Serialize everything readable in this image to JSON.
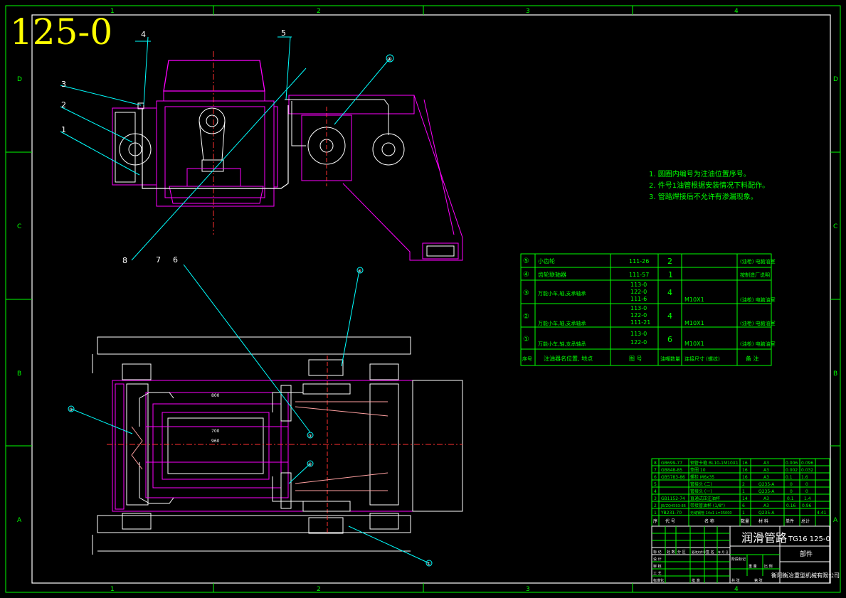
{
  "drawing": {
    "big_title": "125-0",
    "col_markers": [
      "1",
      "2",
      "3",
      "4"
    ],
    "row_markers": [
      "D",
      "C",
      "B",
      "A"
    ],
    "balloons_top": [
      "4",
      "5",
      "3",
      "2",
      "1",
      "8",
      "7",
      "6"
    ],
    "circle_refs": [
      "④",
      "⑤",
      "④",
      "③",
      "②",
      "①"
    ],
    "dims": [
      "800",
      "700",
      "960"
    ],
    "notes": [
      "1. 圆圈内编号为注油位置序号。",
      "2. 件号1油管根据安装情况下料配作。",
      "3. 管路焊接后不允许有渗漏现象。"
    ]
  },
  "parts_table": {
    "rows": [
      {
        "no": "⑤",
        "name": "小齿轮",
        "drawing": [
          "111-26"
        ],
        "qty": "2",
        "size": "",
        "note": "(油枪) 电脑油室"
      },
      {
        "no": "④",
        "name": "齿轮联轴器",
        "drawing": [
          "111-57"
        ],
        "qty": "1",
        "size": "",
        "note": "按制造厂说明"
      },
      {
        "no": "③",
        "name": "万能小车,轴,支承轴承",
        "drawing": [
          "113-0",
          "122-0",
          "111-6"
        ],
        "qty": "4",
        "size": "M10X1",
        "note": "(油枪) 电脑油室"
      },
      {
        "no": "②",
        "name": "万能小车,轴,支承轴承",
        "drawing": [
          "113-0",
          "122-0",
          "111-21"
        ],
        "qty": "4",
        "size": "M10X1",
        "note": "(油枪) 电脑油室"
      },
      {
        "no": "①",
        "name": "万能小车,轴,支承轴承",
        "drawing": [
          "113-0",
          "122-0"
        ],
        "qty": "6",
        "size": "M10X1",
        "note": "(油枪) 电脑油室"
      }
    ],
    "header": [
      "序号",
      "注油器名位置, 地点",
      "图 号",
      "油嘴数量",
      "连接尺寸 (螺纹)",
      "备 注"
    ]
  },
  "bom": {
    "rows": [
      {
        "idx": "8",
        "code": "GB699-77",
        "name": "钢管卡箍 BL10-1M10X1",
        "qty": "16",
        "mat": "A3",
        "w1": "0.006",
        "w2": "0.096"
      },
      {
        "idx": "7",
        "code": "GB848-85",
        "name": "垫圈 10",
        "qty": "16",
        "mat": "A3",
        "w1": "0.002",
        "w2": "0.032"
      },
      {
        "idx": "6",
        "code": "GB5783-86",
        "name": "螺栓 M6x35",
        "qty": "16",
        "mat": "A3",
        "w1": "0.1",
        "w2": "1.6"
      },
      {
        "idx": "5",
        "code": "",
        "name": "管接头 (二)",
        "qty": "2",
        "mat": "Q235-A",
        "w1": "0",
        "w2": "0"
      },
      {
        "idx": "4",
        "code": "",
        "name": "管接头 (一)",
        "qty": "1",
        "mat": "Q235-A",
        "w1": "0",
        "w2": "0"
      },
      {
        "idx": "3",
        "code": "GB1152-74",
        "name": "直通式压注油杯",
        "qty": "14",
        "mat": "A3",
        "w1": "0.1",
        "w2": "1.4"
      },
      {
        "idx": "2",
        "code": "JB/ZQ4593-86",
        "name": "带接管油杯 (1/8\")",
        "qty": "6",
        "mat": "A3",
        "w1": "0.16",
        "w2": "0.96"
      },
      {
        "idx": "1",
        "code": "YB231-70",
        "name": "无缝钢管 14x1 L=35000",
        "qty": "1",
        "mat": "Q235-A",
        "w1": "",
        "w2": "4.41"
      }
    ],
    "header": [
      "序",
      "代 号",
      "名 称",
      "数量",
      "材 料",
      "单件",
      "总计"
    ]
  },
  "title_block": {
    "title": "润滑管路",
    "code": "TG16 125-0",
    "sub": "部件",
    "company": "衡阳衡冶重型机械有限公司",
    "labels": [
      "标 记",
      "处 数",
      "分 区",
      "更改文件号",
      "签 名",
      "年 月 日",
      "设 计",
      "审 核",
      "工 艺",
      "标准化",
      "批 准",
      "阶段标记",
      "重 量",
      "比 例",
      "共 张",
      "第 张"
    ]
  }
}
